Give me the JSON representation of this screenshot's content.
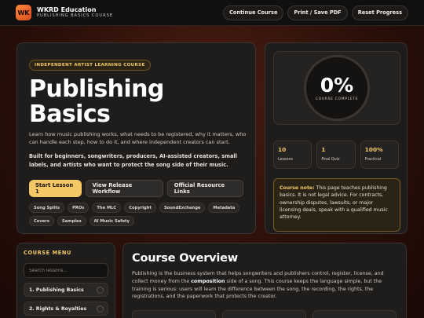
{
  "header": {
    "logo_text": "WK",
    "brand_title": "WKRD Education",
    "brand_subtitle": "PUBLISHING BASICS COURSE",
    "actions": [
      "Continue Course",
      "Print / Save PDF",
      "Reset Progress"
    ]
  },
  "hero": {
    "eyebrow": "INDEPENDENT ARTIST LEARNING COURSE",
    "title": "Publishing Basics",
    "description": "Learn how music publishing works, what needs to be registered, why it matters, who can handle each step, how to do it, and where independent creators can start.",
    "audience": "Built for beginners, songwriters, producers, AI-assisted creators, small labels, and artists who want to protect the song side of their music.",
    "buttons": {
      "start": "Start Lesson 1",
      "workflow": "View Release Workflow",
      "resources": "Official Resource Links"
    },
    "tags": [
      "Song Splits",
      "PROs",
      "The MLC",
      "Copyright",
      "SoundExchange",
      "Metadata",
      "Covers",
      "Samples",
      "AI Music Safety"
    ]
  },
  "progress": {
    "percent": "0%",
    "label": "COURSE COMPLETE",
    "progress_fraction": 0,
    "stats": [
      {
        "value": "10",
        "label": "Lessons"
      },
      {
        "value": "1",
        "label": "Final Quiz"
      },
      {
        "value": "100%",
        "label": "Practical"
      }
    ],
    "note_key": "Course note:",
    "note_text": " This page teaches publishing basics. It is not legal advice. For contracts, ownership disputes, lawsuits, or major licensing deals, speak with a qualified music attorney."
  },
  "menu": {
    "heading": "COURSE MENU",
    "search_placeholder": "Search lessons...",
    "items": [
      "1. Publishing Basics",
      "2. Rights & Royalties"
    ]
  },
  "overview": {
    "title": "Course Overview",
    "text_before": "Publishing is the business system that helps songwriters and publishers control, register, license, and collect money from the ",
    "text_bold": "composition",
    "text_after": " side of a song. This course keeps the language simple, but the training is serious: users will learn the difference between the song, the recording, the rights, the registrations, and the paperwork that protects the creator."
  },
  "colors": {
    "accent": "#f3c865",
    "logo": "#ff8a3d",
    "background": "#2a1009",
    "panel": "#1e1d1c"
  }
}
